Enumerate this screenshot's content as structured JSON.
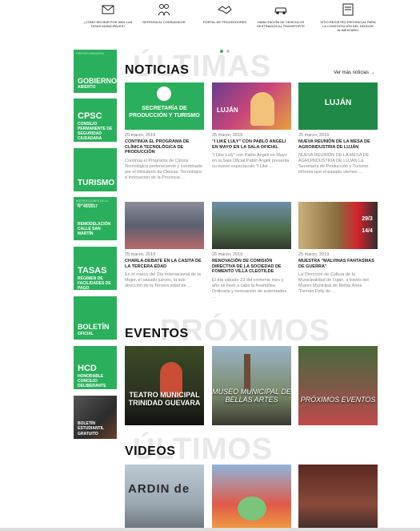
{
  "topbar": {
    "items": [
      {
        "label": "¿Cómo recibir por mail las tasas municipales?",
        "icon": "envelope-icon"
      },
      {
        "label": "Defensa al consumidor",
        "icon": "people-icon"
      },
      {
        "label": "Portal de proveedores",
        "icon": "handshake-icon"
      },
      {
        "label": "Habilitación de vehículos destinados al transporte",
        "icon": "car-icon"
      },
      {
        "label": "Sitio registro provincial para la constatación del deudor alimentario",
        "icon": "document-icon"
      }
    ]
  },
  "sidebar": {
    "tiles": [
      {
        "small": "Gestión municipal",
        "title": "Gobierno",
        "sub": "Abierto"
      },
      {
        "title": "CPSC",
        "sub": "Consejo permanente de seguridad ciudadana"
      },
      {
        "title": "Turismo"
      },
      {
        "small": "Instrucciones de la ordenanza",
        "title": "N° 40/2017",
        "sub": "Remodelación calle San Martín"
      },
      {
        "title": "Tasas",
        "sub": "Régimen de facilidades de pago"
      },
      {
        "title": "Boletín",
        "sub": "Oficial"
      },
      {
        "title": "HCD",
        "sub": "Honorable concejo deliberante"
      },
      {
        "title": "Boletín estudiantil",
        "sub": "Gratuito"
      }
    ]
  },
  "news": {
    "bg_word": "ÚLTIMAS",
    "title": "NOTICIAS",
    "more": "Ver más noticias",
    "cards": [
      {
        "date": "25 marzo, 2019",
        "title": "Continúa el programa de clínica tecnológica de producción",
        "excerpt": "Continúa el Programa de Clínica Tecnológica perteneciente y coordinado por el Ministerio de Ciencia, Tecnología e Innovación de la Provincia ...",
        "img_text": "SECRETARÍA DE PRODUCCIÓN Y TURISMO"
      },
      {
        "date": "25 marzo, 2019",
        "title": "\"I Like Luly\" con Pablo Angeli en mayo en la Sala Oficial",
        "excerpt": "\"I Like Luly\" con Pablo Angeli en Mayo en la Sala Oficial Pablo Angeli presenta su nuevo espectáculo \"I Like ...",
        "img_text": "LUJÁN"
      },
      {
        "date": "25 marzo, 2019",
        "title": "Nueva reunión de la mesa de agroindustria de Luján",
        "excerpt": "NUEVA REUNIÓN DE LA MESA DE AGROINDUSTRIA DE LUJÁN La Secretaría de Producción y Turismo informa que el pasado viernes ...",
        "img_text": "LUJÁN"
      },
      {
        "date": "25 marzo, 2019",
        "title": "Charla-debate en la casita de la tercera edad",
        "excerpt": "En el marco del Día Internacional de la Mujer, el pasado jueves, la sub dirección de la Tercera edad de ...",
        "img_text": ""
      },
      {
        "date": "25 marzo, 2019",
        "title": "Renovación de comisión directiva de la sociedad de fomento villa Cleotilde",
        "excerpt": "El día sábado 23 del corriente mes y año se llevó a cabo la Asamblea Ordinaria y renovación de autoridades ...",
        "img_text": ""
      },
      {
        "date": "25 marzo, 2019",
        "title": "Muestra \"Malvinas fantasmas de guerra\"",
        "excerpt": "La Dirección de Cultura de la Municipalidad de Luján, a través del Museo Municipal de Bellas Artes \"Fernán Félix de ...",
        "img_text": "29/3 14/4"
      }
    ]
  },
  "events": {
    "bg_word": "PRÓXIMOS",
    "title": "EVENTOS",
    "items": [
      {
        "label": "Teatro Municipal Trinidad Guevara"
      },
      {
        "label": "Museo Municipal de Bellas Artes"
      },
      {
        "label": "Próximos Eventos"
      }
    ]
  },
  "videos": {
    "bg_word": "ÚLTIMOS",
    "title": "VIDEOS",
    "items": [
      {
        "img_text": "ARDIN de"
      },
      {
        "img_text": ""
      },
      {
        "img_text": ""
      }
    ]
  },
  "colors": {
    "green": "#2ab05c",
    "dark": "#2b2b2b"
  }
}
